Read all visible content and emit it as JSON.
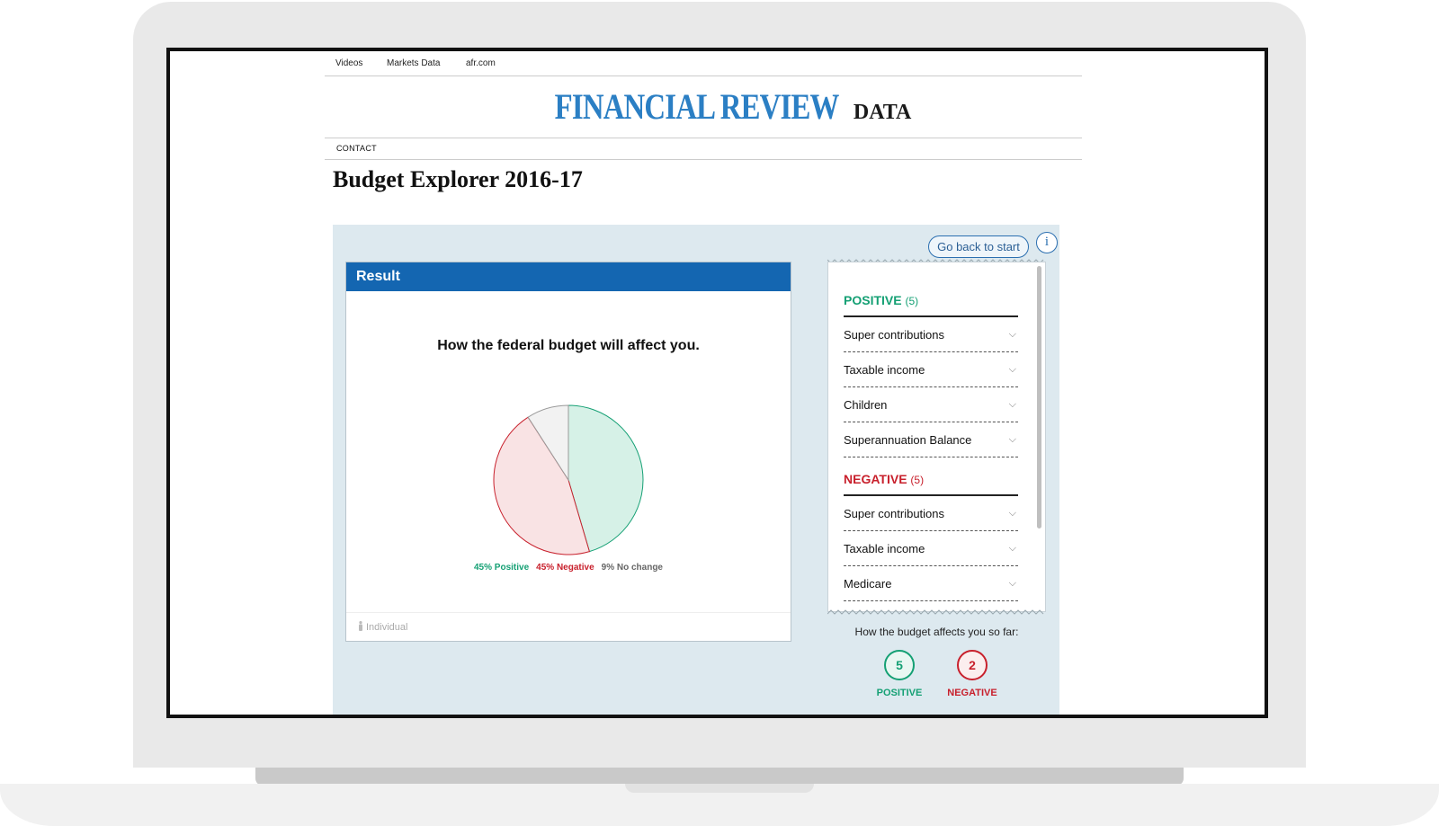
{
  "topnav": {
    "videos": "Videos",
    "markets": "Markets Data",
    "afr": "afr.com"
  },
  "logo": {
    "main": "FINANCIAL REVIEW",
    "sub": "DATA"
  },
  "subnav": {
    "contact": "CONTACT"
  },
  "page_title": "Budget Explorer 2016-17",
  "controls": {
    "back": "Go back to start",
    "info": "i"
  },
  "result": {
    "header": "Result",
    "question": "How the federal budget will affect you.",
    "footer": "Individual",
    "chart_data": {
      "type": "pie",
      "title": "How the federal budget will affect you.",
      "slices": [
        {
          "name": "Positive",
          "value": 45,
          "label": "45% Positive",
          "color": "#15a074",
          "fill": "#d6f1e7"
        },
        {
          "name": "Negative",
          "value": 45,
          "label": "45% Negative",
          "color": "#c8202c",
          "fill": "#f9e3e4"
        },
        {
          "name": "No change",
          "value": 9,
          "label": "9% No change",
          "color": "#9a9a9a",
          "fill": "#f2f2f2"
        }
      ]
    }
  },
  "categories": {
    "positive": {
      "title": "POSITIVE",
      "count": "(5)",
      "items": [
        "Super contributions",
        "Taxable income",
        "Children",
        "Superannuation Balance"
      ]
    },
    "negative": {
      "title": "NEGATIVE",
      "count": "(5)",
      "items": [
        "Super contributions",
        "Taxable income",
        "Medicare"
      ]
    }
  },
  "summary": {
    "label": "How the budget affects you so far:",
    "positive_count": "5",
    "positive_label": "POSITIVE",
    "negative_count": "2",
    "negative_label": "NEGATIVE"
  },
  "colors": {
    "accent": "#1466b1",
    "positive": "#15a074",
    "negative": "#c8202c",
    "panel_bg": "#dde9ef"
  }
}
